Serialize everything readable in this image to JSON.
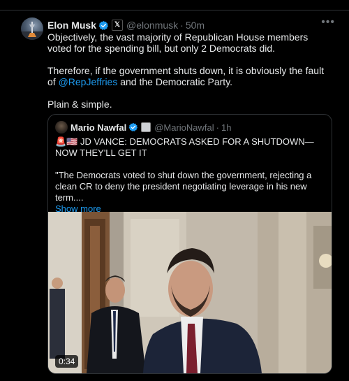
{
  "tweet": {
    "author_name": "Elon Musk",
    "author_handle": "@elonmusk",
    "affiliation_label": "𝕏",
    "time": "50m",
    "paragraphs": [
      "Objectively, the vast majority of Republican House members voted for the spending bill, but only 2 Democrats did.",
      "Therefore, if the government shuts down, it is obviously the fault of",
      "and the Democratic Party.",
      "Plain & simple."
    ],
    "mention": "@RepJeffries",
    "more_icon": "more-dots-icon"
  },
  "quote": {
    "author_name": "Mario Nawfal",
    "author_handle": "@MarioNawfal",
    "time": "1h",
    "headline": "🚨🇺🇸 JD VANCE: DEMOCRATS ASKED FOR A SHUTDOWN—NOW THEY'LL GET IT",
    "text": "\"The Democrats voted to shut down the government, rejecting a clean CR to deny the president negotiating leverage in his new term....",
    "show_more": "Show more",
    "video_duration": "0:34"
  },
  "colors": {
    "background": "#000000",
    "text": "#e7e9ea",
    "secondary": "#71767b",
    "link": "#1d9bf0",
    "border": "#2f3336"
  },
  "dot_separator": "·"
}
